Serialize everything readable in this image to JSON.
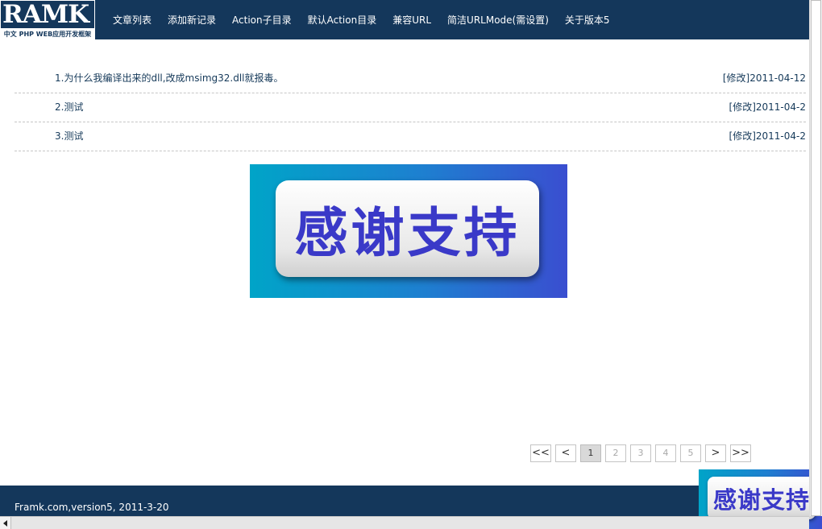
{
  "logo": {
    "word": "RAMK",
    "subtitle": "中文 PHP WEB应用开发框架"
  },
  "nav": {
    "items": [
      {
        "label": "文章列表"
      },
      {
        "label": "添加新记录"
      },
      {
        "label": "Action子目录"
      },
      {
        "label": "默认Action目录"
      },
      {
        "label": "兼容URL"
      },
      {
        "label": "简洁URLMode(需设置)"
      },
      {
        "label": "关于版本5"
      }
    ]
  },
  "articles": [
    {
      "title": "1.为什么我编译出来的dll,改成msimg32.dll就报毒。",
      "edit_label": "[修改]",
      "date": "2011-04-12"
    },
    {
      "title": "2.测试",
      "edit_label": "[修改]",
      "date": "2011-04-2"
    },
    {
      "title": "3.测试",
      "edit_label": "[修改]",
      "date": "2011-04-2"
    }
  ],
  "banner": {
    "text": "感谢支持"
  },
  "pager": {
    "first": "<<",
    "prev": "<",
    "pages": [
      "1",
      "2",
      "3",
      "4",
      "5"
    ],
    "current": "1",
    "next": ">",
    "last": ">>"
  },
  "footer": {
    "text": "Framk.com,version5, 2011-3-20"
  },
  "float_banner": {
    "text": "感谢支持"
  },
  "colors": {
    "header_bg": "#14375b",
    "link": "#163a5a",
    "banner_text": "#3a39c8"
  }
}
